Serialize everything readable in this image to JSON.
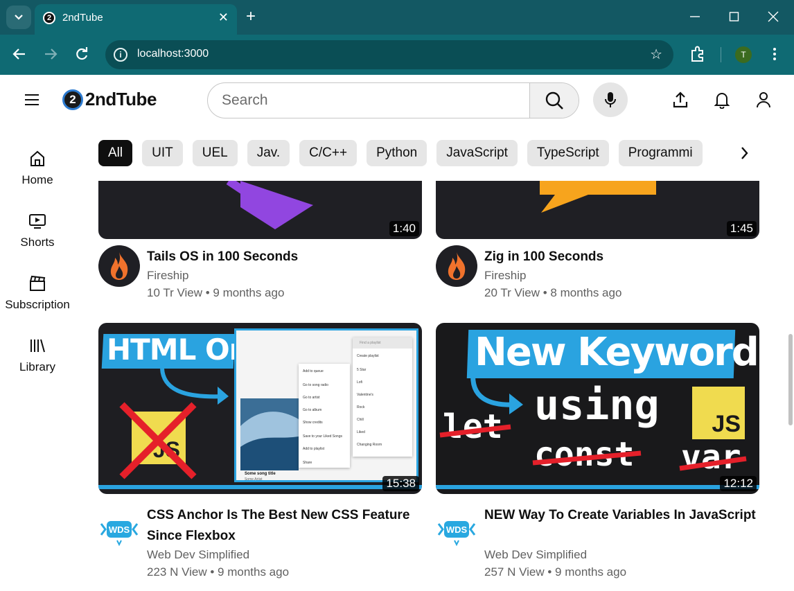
{
  "browser": {
    "tab_title": "2ndTube",
    "favicon_text": "2",
    "url": "localhost:3000",
    "profile_initial": "T",
    "icons": [
      "tab-search-icon",
      "close-icon",
      "plus-icon",
      "minimize-icon",
      "maximize-icon",
      "close-window-icon",
      "back-icon",
      "forward-icon",
      "reload-icon",
      "info-icon",
      "star-icon",
      "extensions-icon",
      "kebab-menu-icon"
    ]
  },
  "header": {
    "logo_badge": "2",
    "logo_text": "2ndTube",
    "search_placeholder": "Search",
    "icons": [
      "menu-icon",
      "search-icon",
      "mic-icon",
      "upload-icon",
      "bell-icon",
      "user-icon"
    ]
  },
  "sidebar": {
    "items": [
      {
        "label": "Home",
        "icon": "home-icon"
      },
      {
        "label": "Shorts",
        "icon": "shorts-icon"
      },
      {
        "label": "Subscription",
        "icon": "subscription-icon"
      },
      {
        "label": "Library",
        "icon": "library-icon"
      }
    ]
  },
  "chips": [
    "All",
    "UIT",
    "UEL",
    "Jav.",
    "C/C++",
    "Python",
    "JavaScript",
    "TypeScript",
    "Programmi"
  ],
  "active_chip": "All",
  "videos": [
    {
      "title": "Tails OS in 100 Seconds",
      "channel": "Fireship",
      "meta": "10 Tr View • 9 months ago",
      "duration": "1:40"
    },
    {
      "title": "Zig in 100 Seconds",
      "channel": "Fireship",
      "meta": "20 Tr View • 8 months ago",
      "duration": "1:45"
    },
    {
      "title": "CSS Anchor Is The Best New CSS Feature Since Flexbox",
      "channel": "Web Dev Simplified",
      "meta": "223 N View • 9 months ago",
      "duration": "15:38",
      "thumb": {
        "headline": "HTML Only",
        "js_badge": "JS",
        "popup_search": "Find a playlist",
        "popup_create": "Create playlist",
        "playlists": [
          "5 Star",
          "Lofi",
          "Valentine's",
          "Rock",
          "Chill",
          "Liked",
          "Changing Room"
        ],
        "menu": [
          "Add to queue",
          "Go to song radio",
          "Go to artist",
          "Go to album",
          "Show credits",
          "Save to your Liked Songs",
          "Add to playlist",
          "Share"
        ],
        "song_title": "Some song title",
        "song_artist": "Some Artist"
      }
    },
    {
      "title": "NEW Way To Create Variables In JavaScript",
      "channel": "Web Dev Simplified",
      "meta": "257 N View • 9 months ago",
      "duration": "12:12",
      "thumb": {
        "headline": "New Keyword",
        "word_using": "using",
        "word_let": "let",
        "word_const": "const",
        "word_var": "var",
        "js_badge": "JS"
      }
    }
  ],
  "colors": {
    "chrome_dark": "#135863",
    "chrome_light": "#0f6a73",
    "fireship_orange": "#f0722c",
    "wds_blue": "#29a8e0",
    "js_yellow": "#f0db4f",
    "strike_red": "#e5202a"
  }
}
